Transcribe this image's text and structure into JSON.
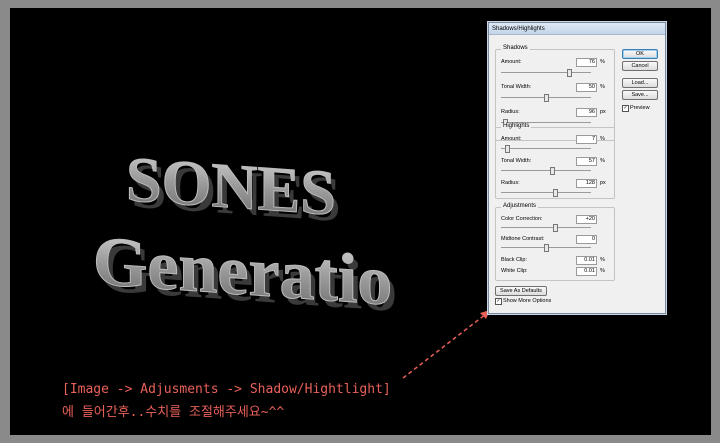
{
  "art": {
    "line1": "SONES",
    "line2": "Generatio"
  },
  "caption": {
    "line1": "[Image -> Adjusments -> Shadow/Hightlight]",
    "line2": "에 들어간후..수치를 조절해주세요~^^"
  },
  "dialog": {
    "title": "Shadows/Highlights",
    "shadows": {
      "legend": "Shadows",
      "amount": {
        "label": "Amount:",
        "value": "76",
        "unit": "%",
        "level": 0.76
      },
      "tonal_width": {
        "label": "Tonal Width:",
        "value": "50",
        "unit": "%",
        "level": 0.5
      },
      "radius": {
        "label": "Radius:",
        "value": "96",
        "unit": "px",
        "level": 0.04
      }
    },
    "highlights": {
      "legend": "Highlights",
      "amount": {
        "label": "Amount:",
        "value": "7",
        "unit": "%",
        "level": 0.07
      },
      "tonal_width": {
        "label": "Tonal Width:",
        "value": "57",
        "unit": "%",
        "level": 0.57
      },
      "radius": {
        "label": "Radius:",
        "value": "128",
        "unit": "px",
        "level": 0.6
      }
    },
    "adjustments": {
      "legend": "Adjustments",
      "color_correction": {
        "label": "Color Correction:",
        "value": "+20",
        "level": 0.6
      },
      "midtone_contrast": {
        "label": "Midtone Contrast:",
        "value": "0",
        "level": 0.5
      },
      "black_clip": {
        "label": "Black Clip:",
        "value": "0.01",
        "unit": "%"
      },
      "white_clip": {
        "label": "White Clip:",
        "value": "0.01",
        "unit": "%"
      }
    },
    "buttons": {
      "ok": "OK",
      "cancel": "Cancel",
      "load": "Load...",
      "save": "Save...",
      "save_defaults": "Save As Defaults"
    },
    "preview": {
      "label": "Preview",
      "checked": true
    },
    "show_more": {
      "label": "Show More Options",
      "checked": true
    }
  },
  "colors": {
    "caption": "#e8605a",
    "arrow": "#e8605a"
  }
}
